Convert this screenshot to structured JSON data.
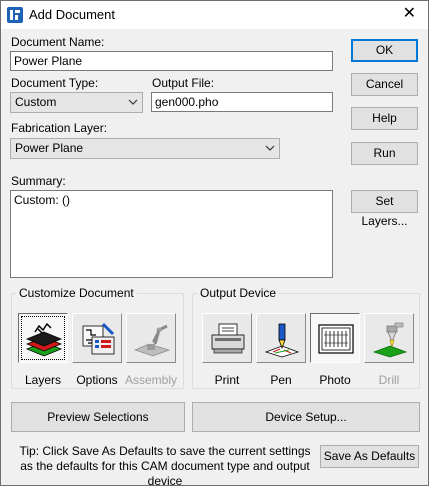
{
  "window": {
    "title": "Add Document",
    "close_glyph": "✕"
  },
  "document_name": {
    "label": "Document Name:",
    "value": "Power Plane"
  },
  "document_type": {
    "label": "Document Type:",
    "value": "Custom"
  },
  "output_file": {
    "label": "Output File:",
    "value": "gen000.pho"
  },
  "fabrication_layer": {
    "label": "Fabrication Layer:",
    "value": "Power Plane"
  },
  "summary": {
    "label": "Summary:",
    "value": "Custom: ()"
  },
  "buttons": {
    "ok": "OK",
    "cancel": "Cancel",
    "help": "Help",
    "run": "Run",
    "set_layers": "Set Layers...",
    "preview_selections": "Preview Selections",
    "device_setup": "Device Setup...",
    "save_as_defaults": "Save As Defaults"
  },
  "customize_document": {
    "title": "Customize Document",
    "items": [
      {
        "label": "Layers",
        "icon": "layers-icon",
        "pressed": true,
        "enabled": true
      },
      {
        "label": "Options",
        "icon": "options-icon",
        "pressed": false,
        "enabled": true
      },
      {
        "label": "Assembly",
        "icon": "assembly-icon",
        "pressed": false,
        "enabled": false
      }
    ]
  },
  "output_device": {
    "title": "Output Device",
    "items": [
      {
        "label": "Print",
        "icon": "printer-icon",
        "pressed": false,
        "enabled": true
      },
      {
        "label": "Pen",
        "icon": "pen-plotter-icon",
        "pressed": false,
        "enabled": true
      },
      {
        "label": "Photo",
        "icon": "photo-plotter-icon",
        "pressed": true,
        "enabled": true
      },
      {
        "label": "Drill",
        "icon": "drill-icon",
        "pressed": false,
        "enabled": false
      }
    ]
  },
  "tip": "Tip: Click Save As Defaults to save the current settings as the defaults for this CAM document type and output device",
  "colors": {
    "accent": "#0078d7",
    "disabled_text": "#a0a0a0",
    "dialog_bg": "#f0f0f0"
  }
}
